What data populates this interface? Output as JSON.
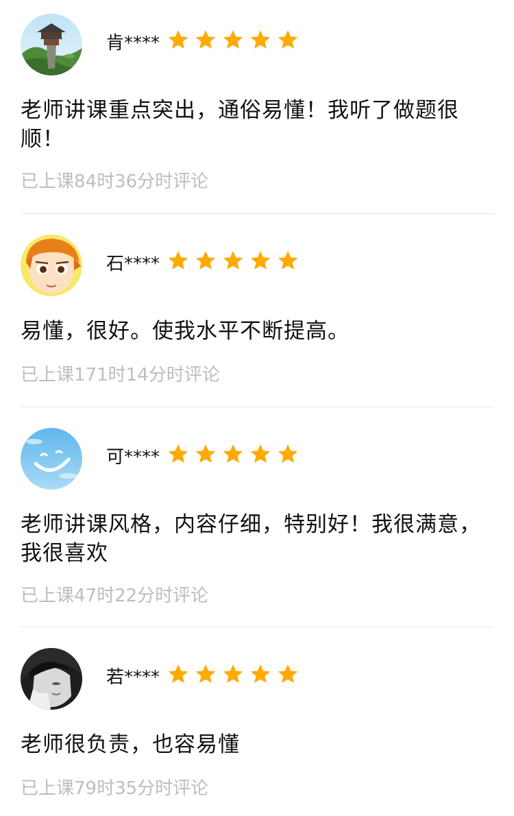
{
  "reviews": [
    {
      "name": "肯****",
      "rating": 5,
      "avatar": "pavilion-landscape-avatar",
      "comment": "老师讲课重点突出，通俗易懂！我听了做题很顺！",
      "meta": "已上课84时36分时评论"
    },
    {
      "name": "石****",
      "rating": 5,
      "avatar": "cartoon-boy-avatar",
      "comment": "易懂，很好。使我水平不断提高。",
      "meta": "已上课171时14分时评论"
    },
    {
      "name": "可****",
      "rating": 5,
      "avatar": "sky-smile-avatar",
      "comment": "老师讲课风格，内容仔细，特别好！我很满意，我很喜欢",
      "meta": "已上课47时22分时评论"
    },
    {
      "name": "若****",
      "rating": 5,
      "avatar": "grayscale-portrait-avatar",
      "comment": "老师很负责，也容易懂",
      "meta": "已上课79时35分时评论"
    }
  ],
  "colors": {
    "star": "#FFAA00",
    "meta_text": "#BDBDBD",
    "divider": "#E6E6E6"
  }
}
